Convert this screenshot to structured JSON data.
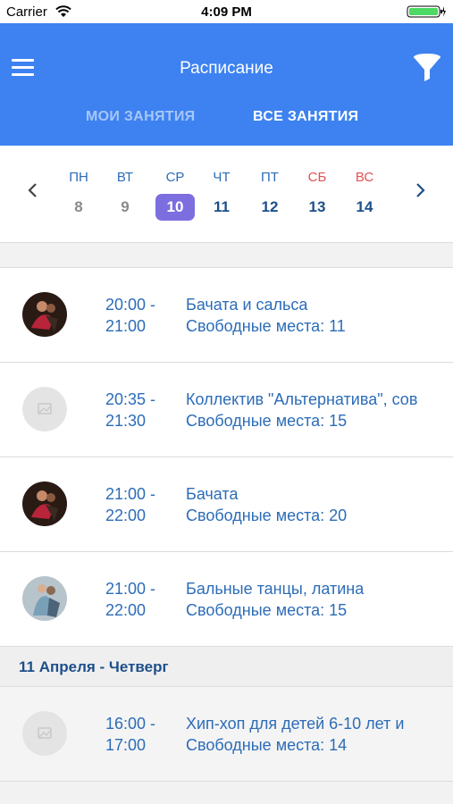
{
  "status": {
    "carrier": "Carrier",
    "time": "4:09 PM"
  },
  "header": {
    "title": "Расписание",
    "tabs": [
      {
        "label": "МОИ ЗАНЯТИЯ",
        "active": false
      },
      {
        "label": "ВСЕ ЗАНЯТИЯ",
        "active": true
      }
    ]
  },
  "week": {
    "days": [
      {
        "name": "ПН",
        "num": "8"
      },
      {
        "name": "ВТ",
        "num": "9"
      },
      {
        "name": "СР",
        "num": "10"
      },
      {
        "name": "ЧТ",
        "num": "11"
      },
      {
        "name": "ПТ",
        "num": "12"
      },
      {
        "name": "СБ",
        "num": "13"
      },
      {
        "name": "ВС",
        "num": "14"
      }
    ],
    "selected_index": 2
  },
  "classes": [
    {
      "start": "20:00 -",
      "end": "21:00",
      "title": "Бачата и сальса",
      "seats": "Свободные места: 11"
    },
    {
      "start": "20:35 -",
      "end": "21:30",
      "title": "Коллектив \"Альтернатива\", сов",
      "seats": "Свободные места: 15"
    },
    {
      "start": "21:00 -",
      "end": "22:00",
      "title": "Бачата",
      "seats": "Свободные места: 20"
    },
    {
      "start": "21:00 -",
      "end": "22:00",
      "title": "Бальные танцы, латина",
      "seats": "Свободные места: 15"
    }
  ],
  "section": {
    "title": "11 Апреля - Четверг"
  },
  "next_day_classes": [
    {
      "start": "16:00 -",
      "end": "17:00",
      "title": "Хип-хоп для детей 6-10 лет и",
      "seats": "Свободные места: 14"
    }
  ],
  "colors": {
    "header": "#3d82f0",
    "accent_text": "#2c6cb8",
    "selected_day": "#7d6ee0",
    "weekend": "#e05252"
  }
}
